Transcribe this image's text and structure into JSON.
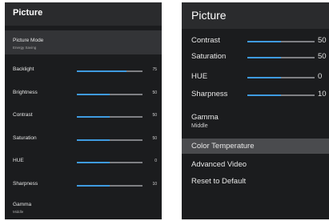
{
  "left_menu": {
    "title": "Picture",
    "picture_mode": {
      "label": "Picture Mode",
      "value": "Energy Saving"
    },
    "sliders": [
      {
        "label": "Backlight",
        "value": "75",
        "level": 0.75
      },
      {
        "label": "Brightness",
        "value": "50",
        "level": 0.5
      },
      {
        "label": "Contrast",
        "value": "50",
        "level": 0.5
      },
      {
        "label": "Saturation",
        "value": "50",
        "level": 0.5
      },
      {
        "label": "HUE",
        "value": "0",
        "level": 0.5
      },
      {
        "label": "Sharpness",
        "value": "10",
        "level": 0.5
      }
    ],
    "gamma": {
      "label": "Gamma",
      "value": "Middle"
    }
  },
  "right_menu": {
    "title": "Picture",
    "sliders": [
      {
        "label": "Contrast",
        "value": "50",
        "level": 0.5
      },
      {
        "label": "Saturation",
        "value": "50",
        "level": 0.5
      },
      {
        "label": "HUE",
        "value": "0",
        "level": 0.5
      },
      {
        "label": "Sharpness",
        "value": "10",
        "level": 0.5
      }
    ],
    "gamma": {
      "label": "Gamma",
      "value": "Middle"
    },
    "items": [
      {
        "label": "Color Temperature"
      },
      {
        "label": "Advanced Video"
      },
      {
        "label": "Reset to Default"
      }
    ]
  },
  "colors": {
    "panel_bg": "#1b1c1e",
    "slider_fill": "#3f9be0",
    "slider_track": "#7f8084",
    "highlight_left": "#333437",
    "highlight_right": "#4a4b4e"
  }
}
